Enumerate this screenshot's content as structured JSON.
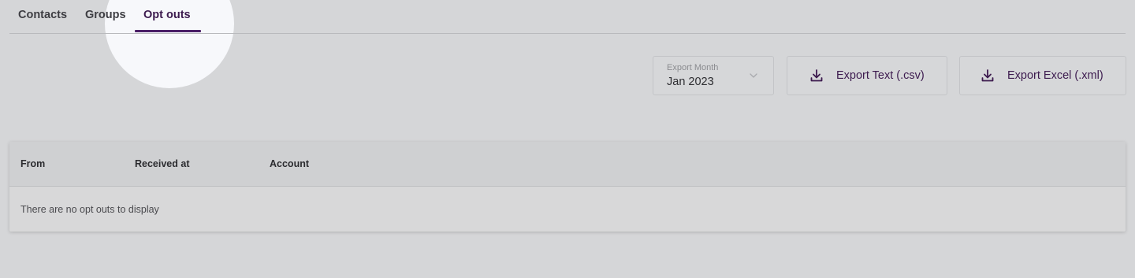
{
  "tabs": [
    {
      "label": "Contacts",
      "active": false
    },
    {
      "label": "Groups",
      "active": false
    },
    {
      "label": "Opt outs",
      "active": true
    }
  ],
  "export": {
    "month_label": "Export Month",
    "month_value": "Jan 2023",
    "csv_label": "Export Text (.csv)",
    "xml_label": "Export Excel (.xml)"
  },
  "table": {
    "columns": [
      "From",
      "Received at",
      "Account"
    ],
    "empty_message": "There are no opt outs to display"
  },
  "colors": {
    "accent": "#4a1e66",
    "background": "#d5d6d8"
  },
  "icons": {
    "chevron": "chevron-down-icon",
    "download": "download-icon"
  }
}
